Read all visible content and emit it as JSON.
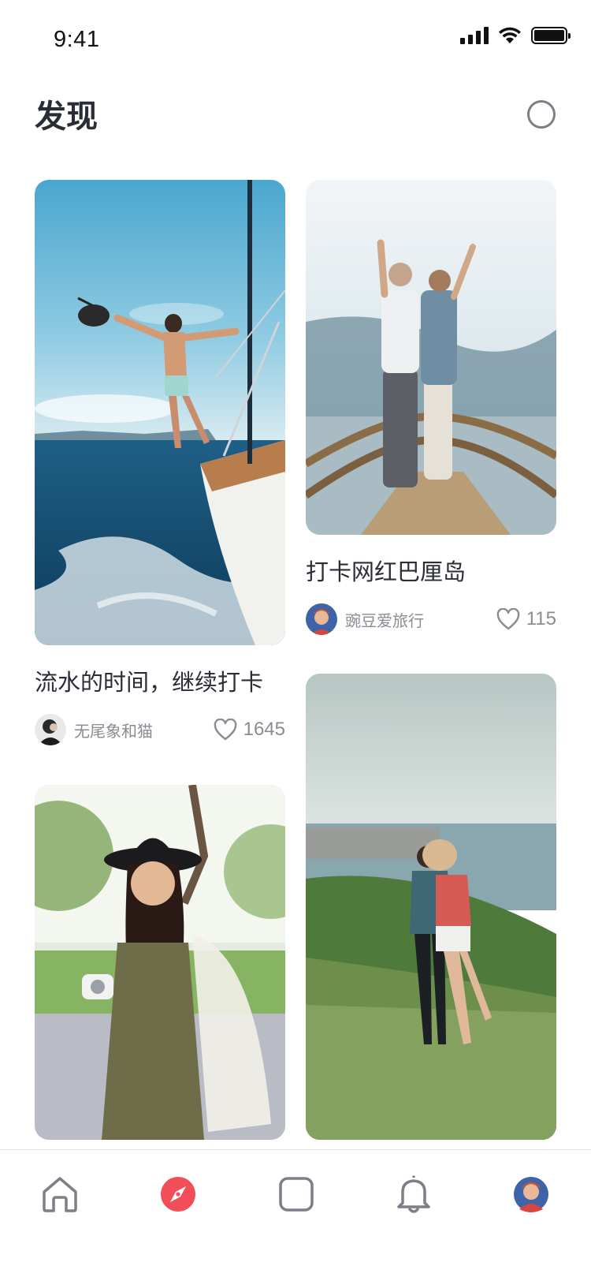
{
  "status_bar": {
    "time": "9:41",
    "icons": [
      "signal-icon",
      "wifi-icon",
      "battery-icon"
    ]
  },
  "header": {
    "title": "发现",
    "action_icon": "circle-icon"
  },
  "cards": [
    {
      "title": "流水的时间，继续打卡",
      "author": "无尾象和猫",
      "likes": "1645",
      "image": "man-on-sailboat-photo"
    },
    {
      "title": "打卡网红巴厘岛",
      "author": "豌豆爱旅行",
      "likes": "115",
      "image": "couple-on-pier-photo"
    },
    {
      "title": "",
      "author": "",
      "likes": "",
      "image": "woman-with-hat-photo"
    },
    {
      "title": "",
      "author": "",
      "likes": "",
      "image": "couple-on-hill-photo"
    }
  ],
  "tab_bar": {
    "items": [
      "home-icon",
      "compass-icon",
      "square-icon",
      "bell-icon",
      "profile-avatar"
    ],
    "active_index": 1
  },
  "colors": {
    "accent": "#f04e58",
    "text": "#2b2d36",
    "muted": "#8a8c93",
    "icon": "#7d7f87"
  }
}
